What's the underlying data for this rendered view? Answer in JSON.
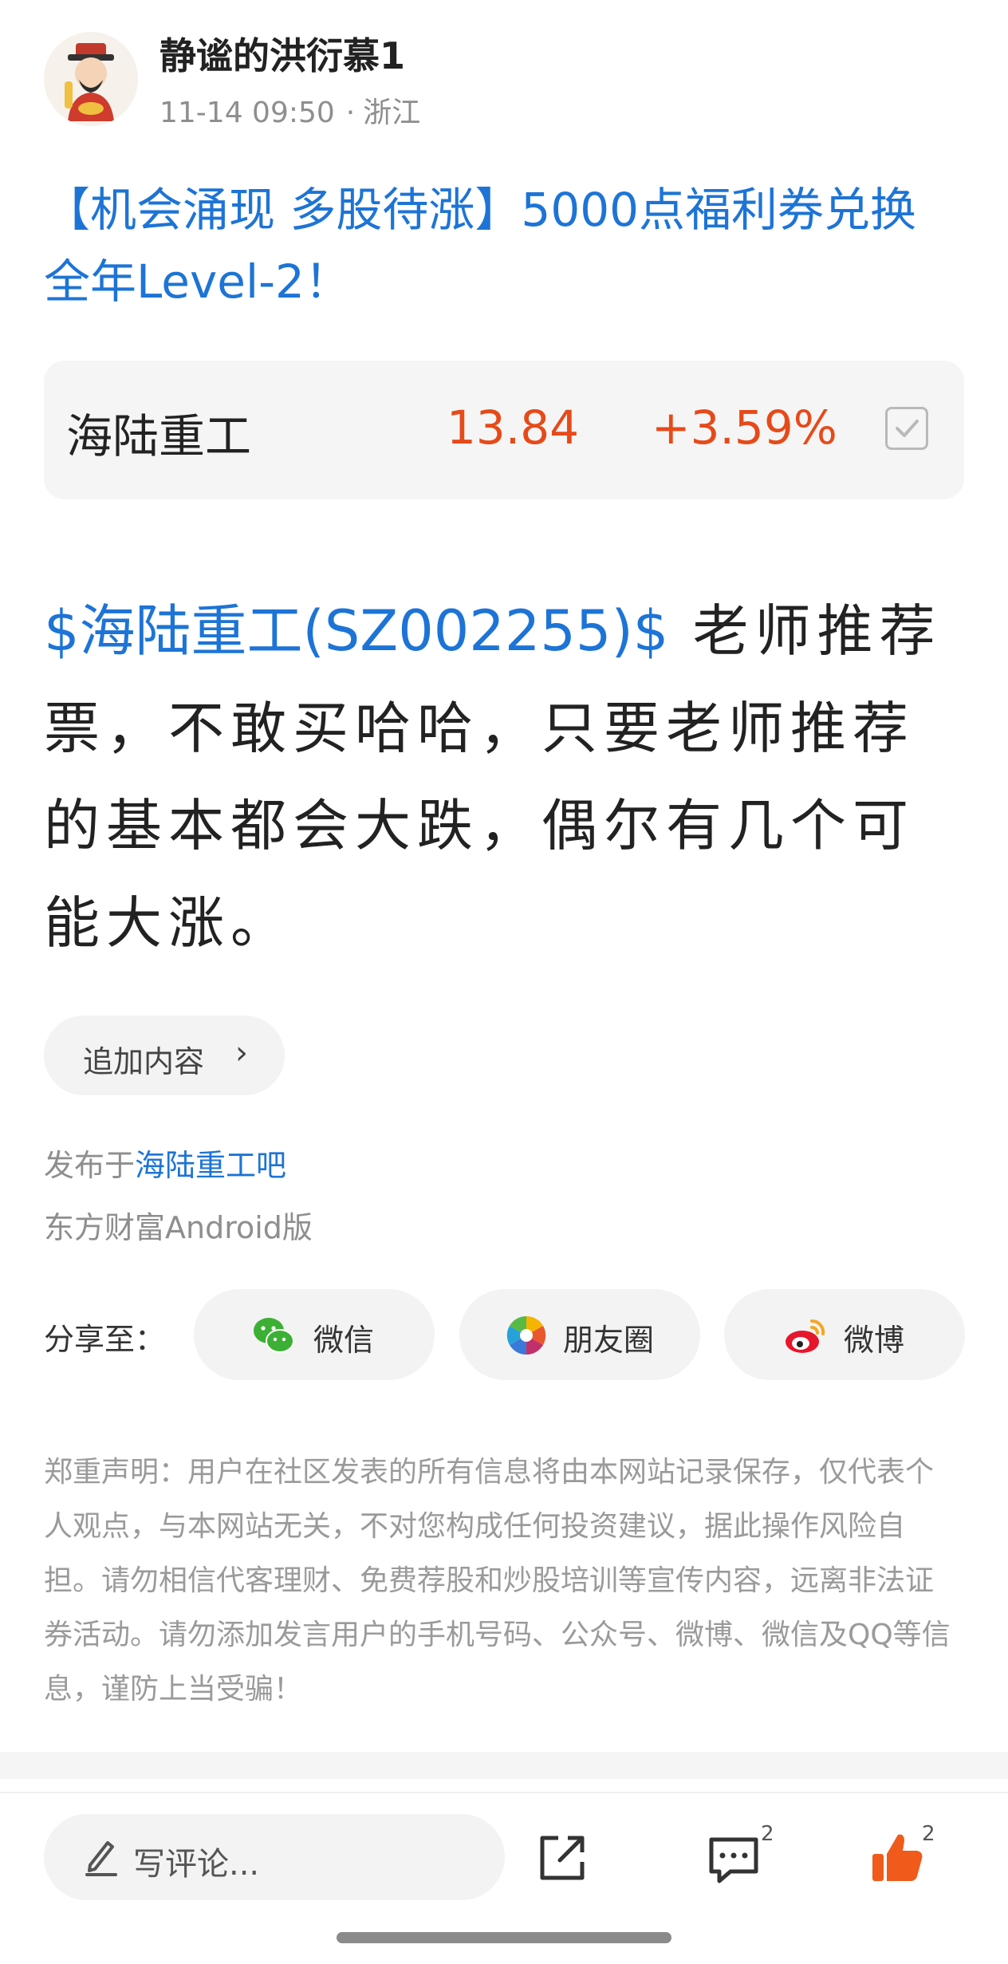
{
  "author": {
    "name": "静谧的洪衍慕1",
    "time": "11-14 09:50",
    "separator": "·",
    "location": "浙江"
  },
  "promo": {
    "text": "【机会涌现 多股待涨】5000点福利券兑换全年Level-2！"
  },
  "stock": {
    "name": "海陆重工",
    "price": "13.84",
    "change": "+3.59%",
    "color_up": "#e64a19"
  },
  "post": {
    "tag": "$海陆重工(SZ002255)$",
    "text": " 老师推荐票，不敢买哈哈，只要老师推荐的基本都会大跌，偶尔有几个可能大涨。"
  },
  "append": {
    "label": "追加内容",
    "chevron": "›"
  },
  "published": {
    "prefix": "发布于",
    "bar_name": "海陆重工吧",
    "client": "东方财富Android版"
  },
  "share": {
    "label": "分享至：",
    "targets": [
      {
        "label": "微信",
        "icon": "wechat-icon"
      },
      {
        "label": "朋友圈",
        "icon": "moments-icon"
      },
      {
        "label": "微博",
        "icon": "weibo-icon"
      }
    ]
  },
  "disclaimer": "郑重声明：用户在社区发表的所有信息将由本网站记录保存，仅代表个人观点，与本网站无关，不对您构成任何投资建议，据此操作风险自担。请勿相信代客理财、免费荐股和炒股培训等宣传内容，远离非法证券活动。请勿添加发言用户的手机号码、公众号、微博、微信及QQ等信息，谨防上当受骗！",
  "bottom_bar": {
    "comment_placeholder": "写评论...",
    "comment_count": "2",
    "like_count": "2"
  },
  "colors": {
    "accent_blue": "#1d74d6",
    "like_orange": "#f05a1a"
  }
}
